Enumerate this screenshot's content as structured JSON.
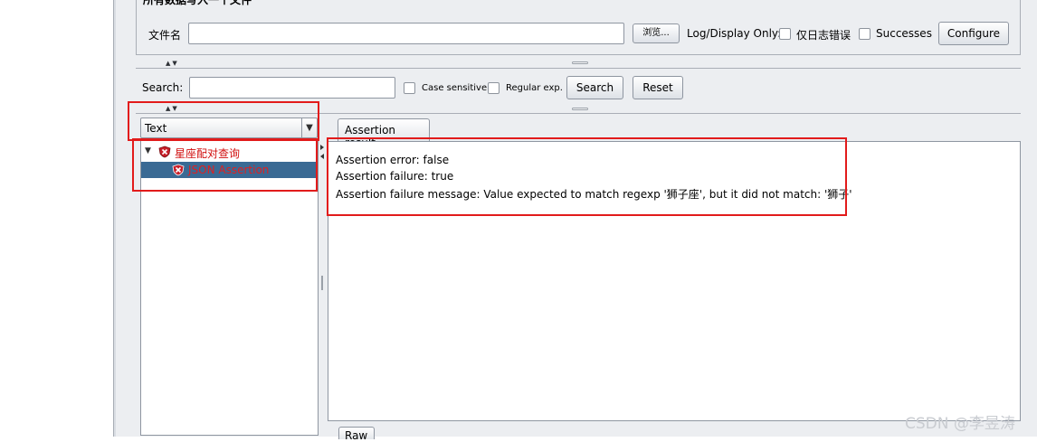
{
  "file_panel": {
    "group_title": "所有数据写入一个文件",
    "filename_label": "文件名",
    "filename_value": "",
    "browse_label": "浏览...",
    "log_display_label": "Log/Display Only:",
    "errors_only_label": "仅日志错误",
    "successes_label": "Successes",
    "configure_label": "Configure"
  },
  "search_bar": {
    "label": "Search:",
    "value": "",
    "case_sensitive_label": "Case sensitive",
    "regex_label": "Regular exp.",
    "search_button": "Search",
    "reset_button": "Reset"
  },
  "renderer_select": {
    "selected": "Text"
  },
  "tree": {
    "items": [
      {
        "label": "星座配对查询",
        "icon": "assertion-failed-shield-icon"
      },
      {
        "label": "JSON Assertion",
        "icon": "assertion-failed-shield-icon",
        "selected": true
      }
    ]
  },
  "results_tabs": {
    "active": "Assertion result",
    "bottom_tab": "Raw"
  },
  "assertion_result": {
    "lines": [
      "Assertion error: false",
      "Assertion failure: true",
      "Assertion failure message: Value expected to match regexp '狮子座', but it did not match: '狮子'"
    ]
  },
  "watermark": "CSDN @李昱涛",
  "colors": {
    "highlight_box": "#e21b1b",
    "selection": "#3a6a94",
    "error_text": "#d10f0f"
  }
}
